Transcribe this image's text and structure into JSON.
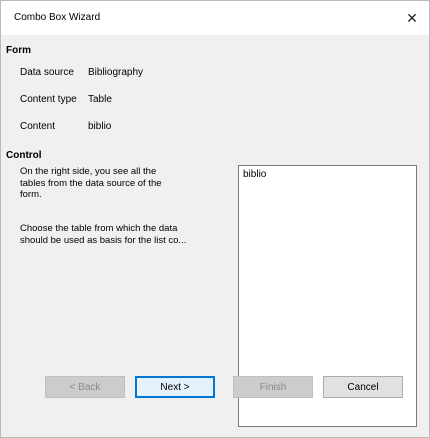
{
  "window": {
    "title": "Combo Box Wizard",
    "close_symbol": "✕"
  },
  "form": {
    "heading": "Form",
    "fields": [
      {
        "label": "Data source",
        "value": "Bibliography"
      },
      {
        "label": "Content type",
        "value": "Table"
      },
      {
        "label": "Content",
        "value": "biblio"
      }
    ]
  },
  "control": {
    "heading": "Control",
    "desc_line1": "On the right side, you see all the",
    "desc_line2": "tables from the data source of the",
    "desc_line3": "form.",
    "desc2_line1": "Choose the table from which the data",
    "desc2_line2": "should be used as basis for the list co...",
    "list_items": [
      "biblio"
    ]
  },
  "buttons": {
    "back": "< Back",
    "next": "Next >",
    "finish": "Finish",
    "cancel": "Cancel"
  }
}
